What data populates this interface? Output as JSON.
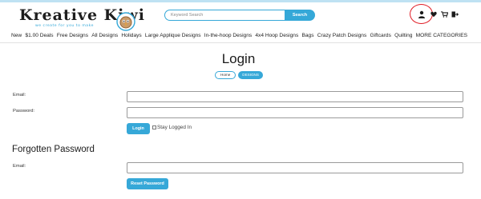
{
  "brand": {
    "name": "Kreative Kiwi",
    "tagline": "we create for you to make"
  },
  "search": {
    "placeholder": "Keyword Search",
    "button_label": "Search"
  },
  "nav": {
    "items": [
      "New",
      "$1.00 Deals",
      "Free Designs",
      "All Designs",
      "Holidays",
      "Large Applique Designs",
      "In-the-hoop Designs",
      "4x4 Hoop Designs",
      "Bags",
      "Crazy Patch Designs",
      "Giftcards",
      "Quilting",
      "MORE CATEGORIES"
    ]
  },
  "page": {
    "title": "Login"
  },
  "breadcrumb": {
    "home": "Home",
    "current": "DESIGNS"
  },
  "login_form": {
    "email_label": "Email:",
    "email_value": "",
    "password_label": "Password:",
    "password_value": "",
    "login_button": "Login",
    "stay_logged_in": "Stay Logged In",
    "stay_logged_in_checked": false
  },
  "forgot_form": {
    "title": "Forgotten Password",
    "email_label": "Email:",
    "email_value": "",
    "reset_button": "Reset Password"
  },
  "icons": [
    "account-icon",
    "heart-icon",
    "cart-icon",
    "logout-icon",
    "kiwi-mascot-icon"
  ],
  "colors": {
    "accent": "#36a8d8",
    "highlight": "#e01b24",
    "text": "#222222"
  }
}
